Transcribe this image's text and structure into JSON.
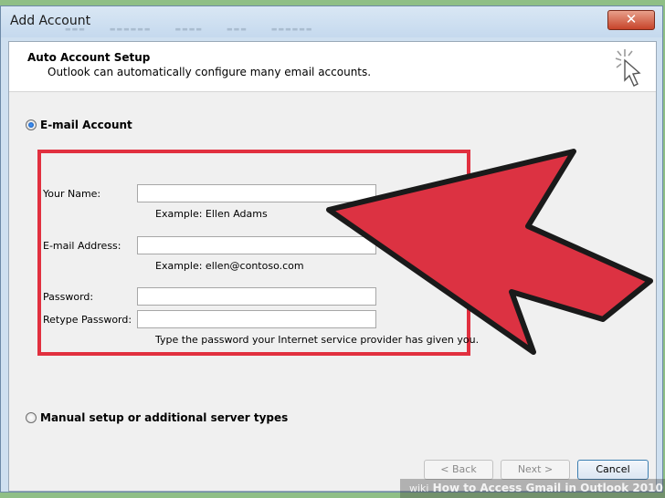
{
  "window": {
    "title": "Add Account",
    "close_glyph": "✕"
  },
  "header": {
    "title": "Auto Account Setup",
    "subtitle": "Outlook can automatically configure many email accounts."
  },
  "email_option": {
    "label": "E-mail Account",
    "selected": true
  },
  "form": {
    "name_label": "Your Name:",
    "name_value": "",
    "name_hint": "Example: Ellen Adams",
    "email_label": "E-mail Address:",
    "email_value": "",
    "email_hint": "Example: ellen@contoso.com",
    "password_label": "Password:",
    "retype_label": "Retype Password:",
    "password_hint": "Type the password your Internet service provider has given you."
  },
  "manual_option": {
    "label": "Manual setup or additional server types",
    "selected": false
  },
  "buttons": {
    "back": "< Back",
    "next": "Next >",
    "cancel": "Cancel"
  },
  "watermark": {
    "brand": "wiki",
    "text": "How to Access Gmail in Outlook 2010"
  },
  "colors": {
    "highlight_red": "#e1303f",
    "arrow_fill": "#dc3242"
  },
  "icons": {
    "wizard": "wizard-sparkle-icon",
    "arrow": "red-pointer-arrow"
  }
}
